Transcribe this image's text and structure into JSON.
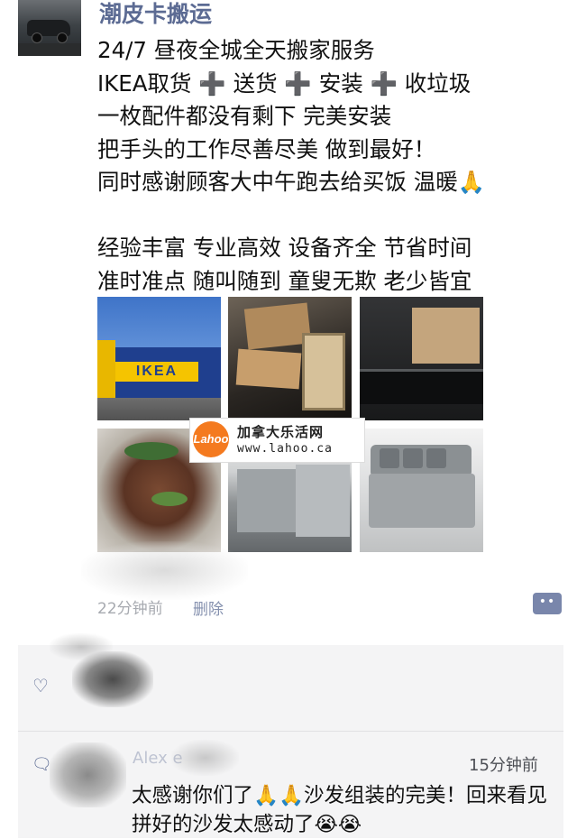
{
  "post": {
    "username": "潮皮卡搬运",
    "lines": [
      "24/7 昼夜全城全天搬家服务",
      "IKEA取货 ➕ 送货 ➕ 安装 ➕ 收垃圾",
      "一枚配件都没有剩下 完美安装",
      "把手头的工作尽善尽美 做到最好！",
      "同时感谢顾客大中午跑去给买饭 温暖🙏",
      "",
      "经验丰富 专业高效 设备齐全 节省时间",
      "准时准点 随叫随到 童叟无欺 老少皆宜"
    ],
    "photo_sign_text": "IKEA",
    "timestamp": "22分钟前",
    "delete_label": "删除",
    "comment_button_glyph": "••"
  },
  "watermark": {
    "logo_text": "Lahoo",
    "title": "加拿大乐活网",
    "url": "www.lahoo.ca"
  },
  "comments": {
    "like_icon": "heart-outline-icon",
    "comment_icon": "speech-bubble-icon",
    "item": {
      "author": "Alex e",
      "time": "15分钟前",
      "text": "太感谢你们了🙏🙏沙发组装的完美！回来看见拼好的沙发太感动了😭😭"
    }
  }
}
